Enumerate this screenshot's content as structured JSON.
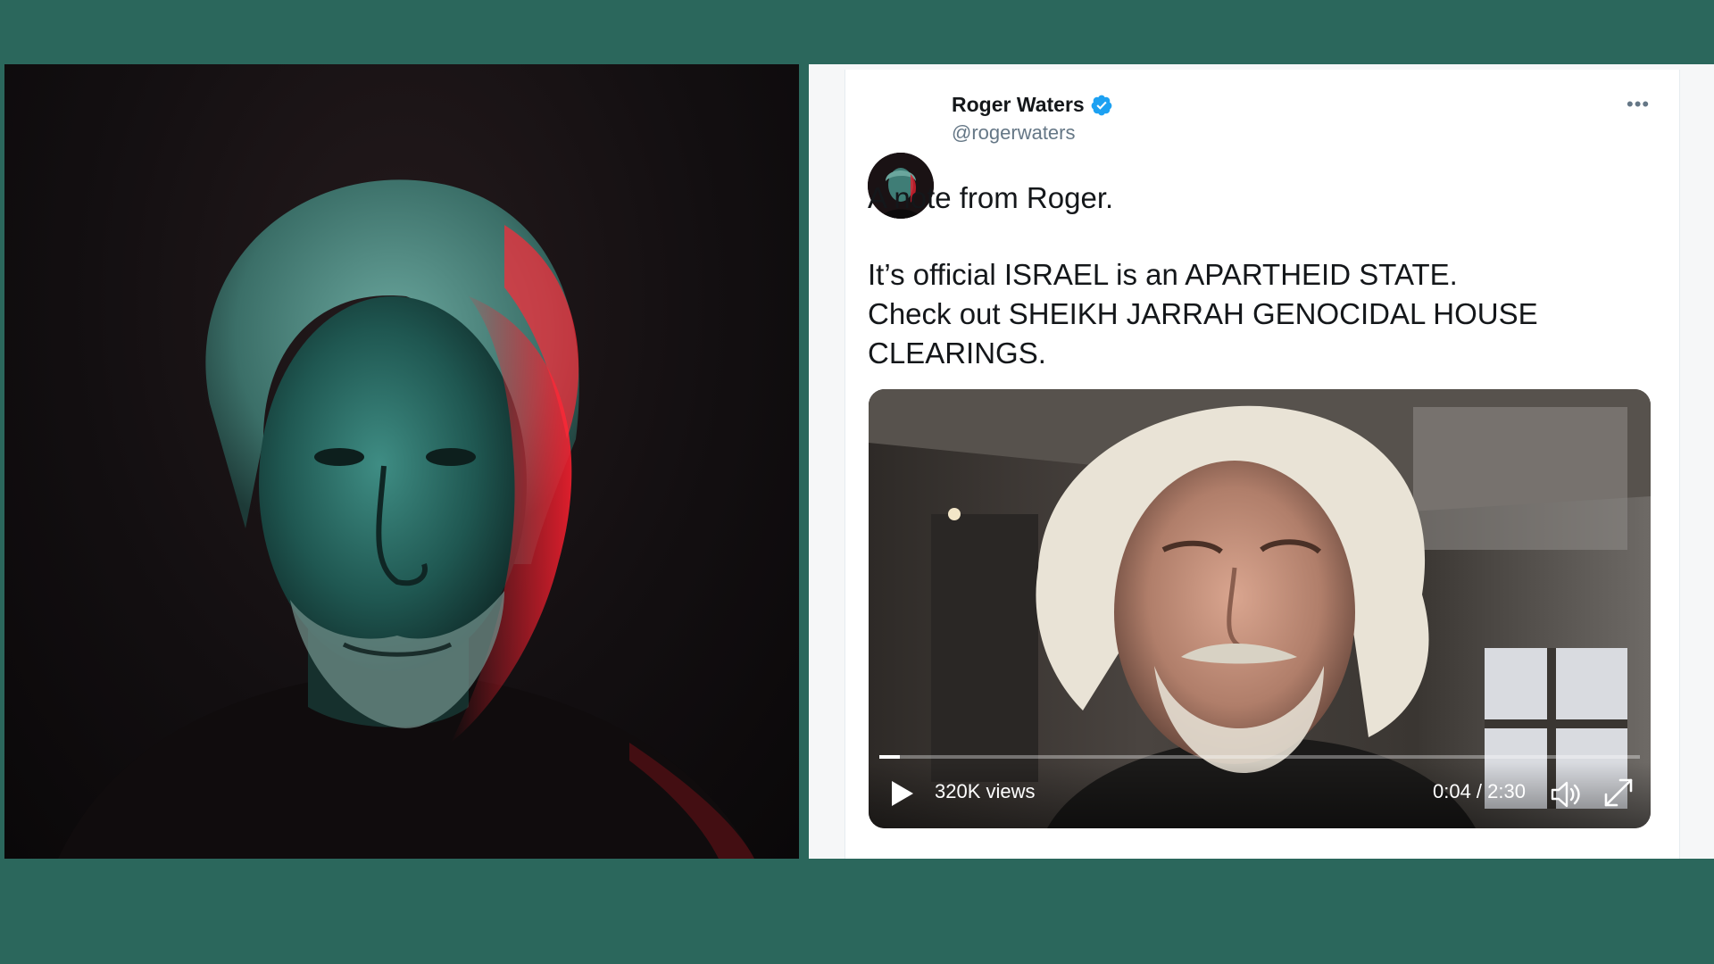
{
  "tweet": {
    "display_name": "Roger Waters",
    "handle": "@rogerwaters",
    "verified": true,
    "more_label": "•••",
    "text_line1": "A note from Roger.",
    "text_line2": "It’s official ISRAEL is an APARTHEID STATE.",
    "text_line3": "Check out SHEIKH JARRAH GENOCIDAL HOUSE",
    "text_line4": "CLEARINGS."
  },
  "video": {
    "views": "320K views",
    "time": "0:04 / 2:30",
    "progress_fraction": 0.027
  },
  "colors": {
    "background": "#2b675c",
    "verified_blue": "#1da1f2",
    "name_text": "#14171a",
    "handle_text": "#657786"
  },
  "icons": [
    "verified-badge-icon",
    "more-options-icon",
    "play-icon",
    "volume-icon",
    "fullscreen-icon"
  ]
}
